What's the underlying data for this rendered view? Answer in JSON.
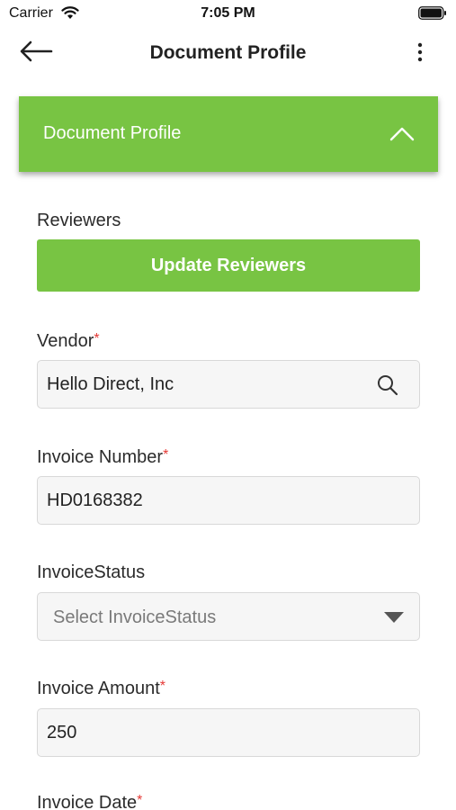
{
  "status_bar": {
    "carrier": "Carrier",
    "time": "7:05 PM"
  },
  "nav": {
    "title": "Document Profile"
  },
  "section": {
    "title": "Document Profile",
    "expanded": true
  },
  "reviewers": {
    "label": "Reviewers",
    "button_label": "Update Reviewers"
  },
  "vendor": {
    "label": "Vendor",
    "required": "*",
    "value": "Hello Direct, Inc"
  },
  "invoice_number": {
    "label": "Invoice Number",
    "required": "*",
    "value": "HD0168382"
  },
  "invoice_status": {
    "label": "InvoiceStatus",
    "placeholder": "Select InvoiceStatus"
  },
  "invoice_amount": {
    "label": "Invoice Amount",
    "required": "*",
    "value": "250"
  },
  "invoice_date": {
    "label": "Invoice Date",
    "required": "*"
  },
  "colors": {
    "accent_green": "#78c443",
    "required_red": "#e53935"
  }
}
